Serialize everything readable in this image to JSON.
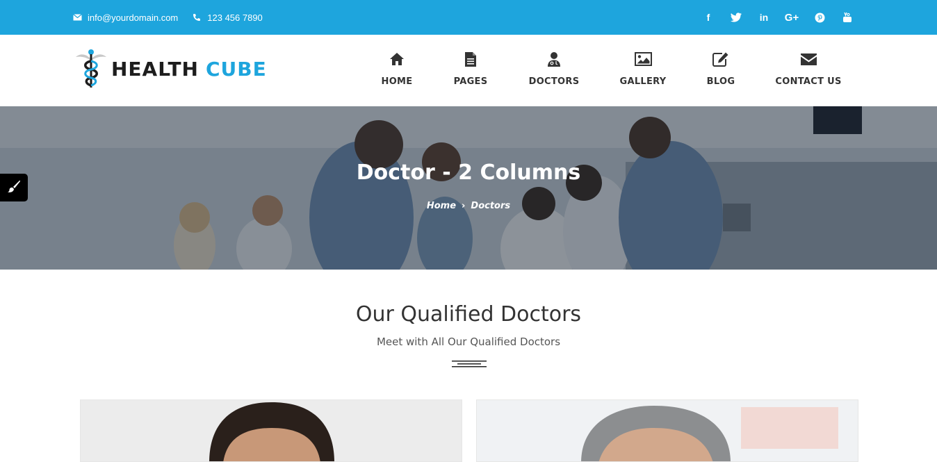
{
  "topbar": {
    "email": "info@yourdomain.com",
    "phone": "123 456 7890",
    "social": [
      "facebook-icon",
      "twitter-icon",
      "linkedin-icon",
      "google-plus-icon",
      "pinterest-icon",
      "youtube-icon"
    ]
  },
  "logo": {
    "word1": "HEALTH",
    "word2": "CUBE"
  },
  "nav": {
    "items": [
      {
        "label": "HOME",
        "icon": "home-icon"
      },
      {
        "label": "PAGES",
        "icon": "document-icon"
      },
      {
        "label": "DOCTORS",
        "icon": "doctor-icon"
      },
      {
        "label": "GALLERY",
        "icon": "image-icon"
      },
      {
        "label": "BLOG",
        "icon": "edit-icon"
      },
      {
        "label": "CONTACT US",
        "icon": "envelope-icon"
      }
    ]
  },
  "banner": {
    "title": "Doctor - 2 Columns",
    "breadcrumb_home": "Home",
    "breadcrumb_sep": "›",
    "breadcrumb_current": "Doctors"
  },
  "section": {
    "title": "Our Qualified Doctors",
    "subtitle": "Meet with All Our Qualified Doctors"
  },
  "colors": {
    "brand": "#1ea5dd",
    "text": "#333333"
  }
}
